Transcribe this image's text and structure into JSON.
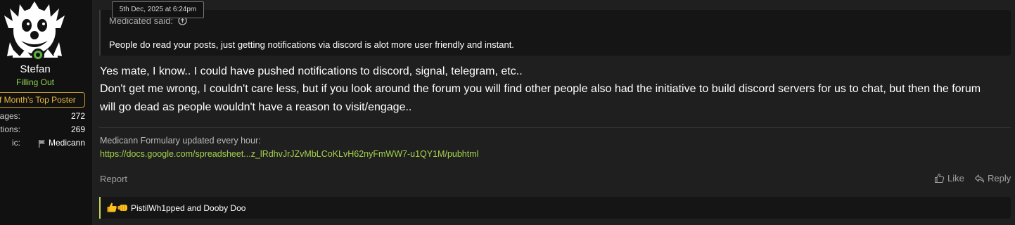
{
  "tooltip": {
    "timestamp": "5th Dec, 2025 at 6:24pm"
  },
  "user": {
    "name": "Stefan",
    "title": "Filling Out",
    "banner": "f Month's Top Poster",
    "stats": [
      {
        "key": "ssages:",
        "value": "272"
      },
      {
        "key": "es/Reactions:",
        "value": "269"
      },
      {
        "key": "ic:",
        "value": "Medicann"
      }
    ],
    "colors": {
      "title": "#8fd14f",
      "banner": "#e9b93c",
      "online": "#5db33f"
    }
  },
  "quote": {
    "author": "Medicated said:",
    "icon": "arrow-up-circle-icon",
    "text": "People do read your posts, just getting notifications via discord is alot more user friendly and instant."
  },
  "message": {
    "lines": [
      "Yes mate, I know.. I could have pushed notifications to discord, signal, telegram, etc..",
      "Don't get me wrong, I couldn't care less, but if you look around the forum you will find other people also had the initiative to build discord servers for us to chat, but then the forum",
      "will go dead as people wouldn't have a reason to visit/engage.."
    ]
  },
  "signature": {
    "label": "Medicann Formulary updated every hour:",
    "link": "https://docs.google.com/spreadsheet...z_lRdhvJrJZvMbLCoKLvH62nyFmWW7-u1QY1M/pubhtml",
    "link_color": "#a5d24b"
  },
  "actions": {
    "report": "Report",
    "like": "Like",
    "reply": "Reply"
  },
  "reactions": {
    "emojis": [
      "thumbs-up-icon",
      "fist-bump-icon"
    ],
    "text": "PistilWh1pped and Dooby Doo",
    "accent": "#c4d75a"
  }
}
